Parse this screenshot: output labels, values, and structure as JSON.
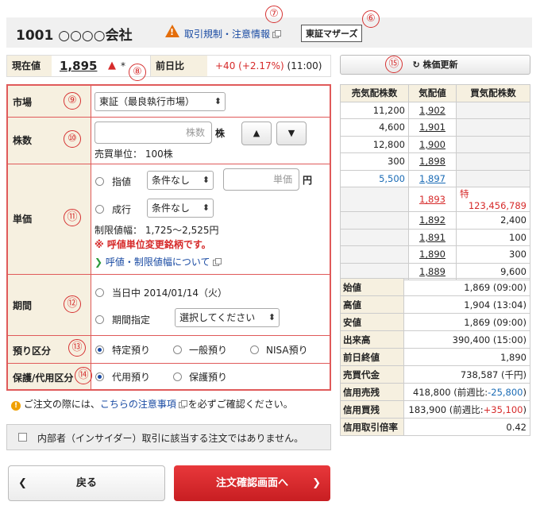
{
  "header": {
    "stock_title": "1001 ○○○○会社",
    "link_text": "取引規制・注意情報",
    "market_badge": "東証マザーズ"
  },
  "callouts": [
    "⑥",
    "⑦",
    "⑧",
    "⑨",
    "⑩",
    "⑪",
    "⑫",
    "⑬",
    "⑭",
    "⑮"
  ],
  "price": {
    "label": "現在値",
    "value": "1,895",
    "arrow": "▲",
    "asterisk": "*",
    "change_label": "前日比",
    "change": "+40",
    "change_pct": "(+2.17%)",
    "time": "(11:00)"
  },
  "form": {
    "market": {
      "label": "市場",
      "value": "東証（最良執行市場）"
    },
    "qty": {
      "label": "株数",
      "placeholder": "株数",
      "unit": "株",
      "up": "▲",
      "down": "▼",
      "lot": "売買単位： 100株"
    },
    "price": {
      "label": "単価",
      "limit": "指値",
      "limit_cond": "条件なし",
      "price_placeholder": "単価",
      "yen": "円",
      "market": "成行",
      "market_cond": "条件なし",
      "range": "制限値幅： 1,725～2,525円",
      "warning": "※ 呼値単位変更銘柄です。",
      "link": "呼値・制限値幅について",
      "link_arrow": "❯"
    },
    "period": {
      "label": "期間",
      "today": "当日中 2014/01/14（火）",
      "specified": "期間指定",
      "select": "選択してください"
    },
    "account": {
      "label": "預り区分",
      "opt1": "特定預り",
      "opt2": "一般預り",
      "opt3": "NISA預り"
    },
    "custody": {
      "label": "保護/代用区分",
      "opt1": "代用預り",
      "opt2": "保護預り"
    }
  },
  "refresh_label": "株価更新",
  "refresh_icon": "↻",
  "board": {
    "headers": [
      "売気配株数",
      "気配値",
      "買気配株数"
    ],
    "rows": [
      {
        "sell": "11,200",
        "price": "1,902",
        "buy": ""
      },
      {
        "sell": "4,600",
        "price": "1,901",
        "buy": ""
      },
      {
        "sell": "12,800",
        "price": "1,900",
        "buy": ""
      },
      {
        "sell": "300",
        "price": "1,898",
        "buy": ""
      },
      {
        "sell": "5,500",
        "price": "1,897",
        "buy": ""
      },
      {
        "sell": "",
        "price": "1,893",
        "buy": "123,456,789",
        "tag": "特"
      },
      {
        "sell": "",
        "price": "1,892",
        "buy": "2,400"
      },
      {
        "sell": "",
        "price": "1,891",
        "buy": "100"
      },
      {
        "sell": "",
        "price": "1,890",
        "buy": "300"
      },
      {
        "sell": "",
        "price": "1,889",
        "buy": "9,600"
      }
    ]
  },
  "info": [
    {
      "k": "始値",
      "v": "1,869 (09:00)"
    },
    {
      "k": "高値",
      "v": "1,904 (13:04)"
    },
    {
      "k": "安値",
      "v": "1,869 (09:00)"
    },
    {
      "k": "出来高",
      "v": "390,400 (15:00)"
    },
    {
      "k": "前日終値",
      "v": "1,890"
    },
    {
      "k": "売買代金",
      "v": "738,587 (千円)"
    },
    {
      "k": "信用売残",
      "v": "418,800 (前週比:",
      "d": "-25,800",
      "e": ")"
    },
    {
      "k": "信用買残",
      "v": "183,900 (前週比:",
      "d": "+35,100",
      "e": ")"
    },
    {
      "k": "信用取引倍率",
      "v": "0.42"
    }
  ],
  "notice": {
    "pre": "ご注文の際には、",
    "link": "こちらの注意事項",
    "post": "を必ずご確認ください。"
  },
  "insider": "内部者（インサイダー）取引に該当する注文ではありません。",
  "buttons": {
    "back": "戻る",
    "back_arrow": "❮",
    "confirm": "注文確認画面へ",
    "confirm_arrow": "❯"
  }
}
